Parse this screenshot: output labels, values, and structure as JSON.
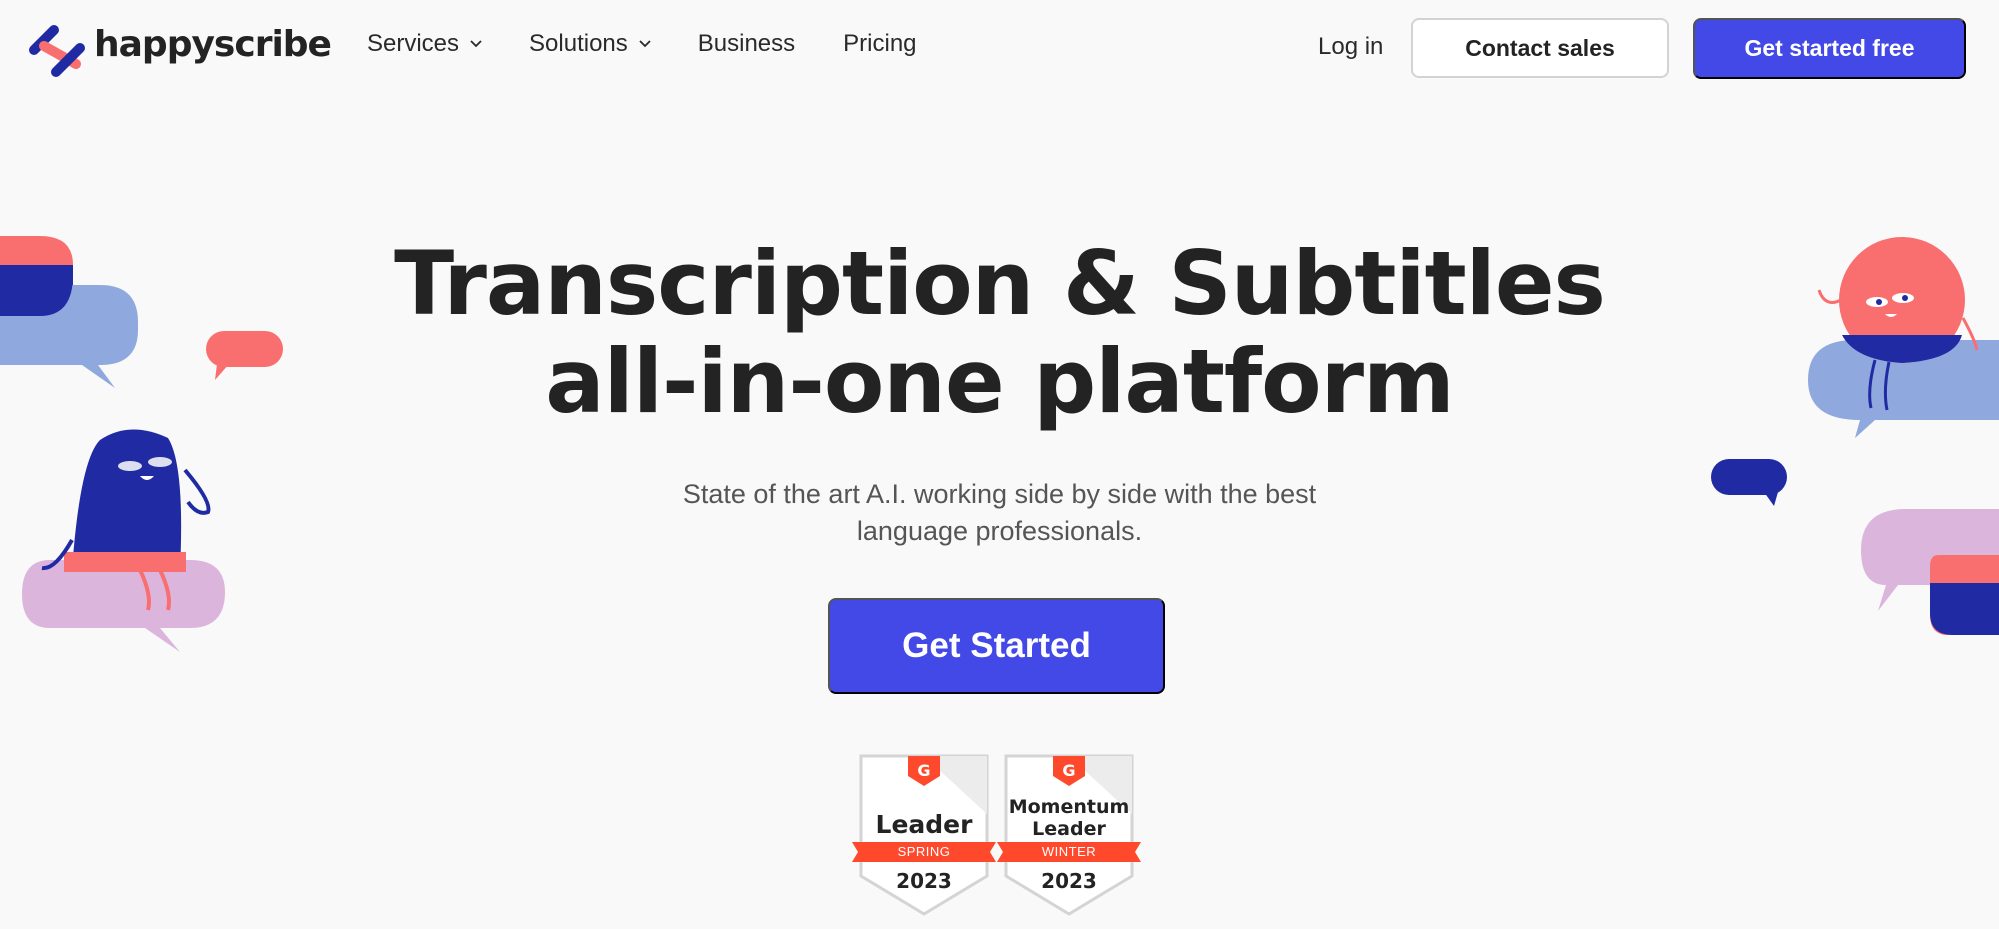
{
  "brand": {
    "name": "happyscribe",
    "colors": {
      "primary": "#4349e6",
      "dark_blue": "#1f2aa3",
      "coral": "#f96f6f",
      "light_blue": "#8fa8de",
      "lilac": "#dcb5dd",
      "g2_red": "#ff492c"
    }
  },
  "nav": {
    "items": [
      {
        "label": "Services",
        "icon": "chevron-down-icon"
      },
      {
        "label": "Solutions",
        "icon": "chevron-down-icon"
      },
      {
        "label": "Business"
      },
      {
        "label": "Pricing"
      }
    ],
    "login": "Log in",
    "contact_sales": "Contact sales",
    "get_started_free": "Get started free"
  },
  "hero": {
    "title_line1": "Transcription & Subtitles",
    "title_line2": "all-in-one platform",
    "subtitle_line1": "State of the art A.I. working side by side with the best",
    "subtitle_line2": "language professionals.",
    "cta": "Get Started"
  },
  "badges": [
    {
      "title_line1": "Leader",
      "title_line2": "",
      "season": "SPRING",
      "year": "2023"
    },
    {
      "title_line1": "Momentum",
      "title_line2": "Leader",
      "season": "WINTER",
      "year": "2023"
    }
  ]
}
